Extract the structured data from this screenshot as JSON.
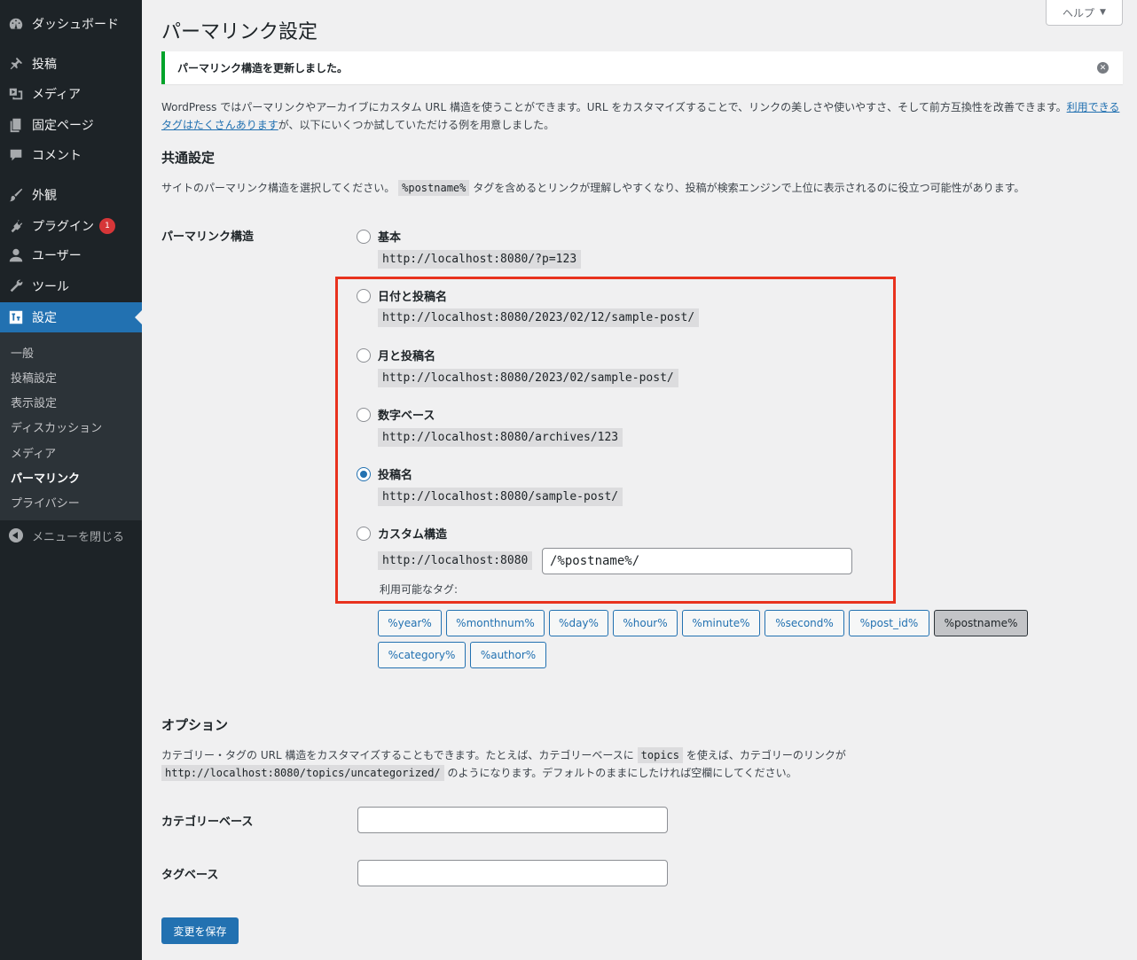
{
  "sidebar": {
    "items": [
      {
        "label": "ダッシュボード",
        "icon": "dashboard-icon"
      },
      {
        "label": "投稿",
        "icon": "pin-icon"
      },
      {
        "label": "メディア",
        "icon": "media-icon"
      },
      {
        "label": "固定ページ",
        "icon": "page-icon"
      },
      {
        "label": "コメント",
        "icon": "comment-icon"
      },
      {
        "label": "外観",
        "icon": "brush-icon"
      },
      {
        "label": "プラグイン",
        "icon": "plugin-icon",
        "badge": "1"
      },
      {
        "label": "ユーザー",
        "icon": "user-icon"
      },
      {
        "label": "ツール",
        "icon": "wrench-icon"
      },
      {
        "label": "設定",
        "icon": "settings-icon"
      }
    ],
    "submenu": [
      "一般",
      "投稿設定",
      "表示設定",
      "ディスカッション",
      "メディア",
      "パーマリンク",
      "プライバシー"
    ],
    "collapse_label": "メニューを閉じる"
  },
  "header": {
    "help_label": "ヘルプ",
    "title": "パーマリンク設定"
  },
  "notice": {
    "text": "パーマリンク構造を更新しました。"
  },
  "intro": {
    "text_before": "WordPress ではパーマリンクやアーカイブにカスタム URL 構造を使うことができます。URL をカスタマイズすることで、リンクの美しさや使いやすさ、そして前方互換性を改善できます。",
    "link": "利用できるタグはたくさんあります",
    "text_after": "が、以下にいくつか試していただける例を用意しました。"
  },
  "common": {
    "heading": "共通設定",
    "desc_before": "サイトのパーマリンク構造を選択してください。",
    "desc_code": "%postname%",
    "desc_after": "タグを含めるとリンクが理解しやすくなり、投稿が検索エンジンで上位に表示されるのに役立つ可能性があります。",
    "field_label": "パーマリンク構造"
  },
  "structures": [
    {
      "label": "基本",
      "url": "http://localhost:8080/?p=123",
      "checked": false
    },
    {
      "label": "日付と投稿名",
      "url": "http://localhost:8080/2023/02/12/sample-post/",
      "checked": false
    },
    {
      "label": "月と投稿名",
      "url": "http://localhost:8080/2023/02/sample-post/",
      "checked": false
    },
    {
      "label": "数字ベース",
      "url": "http://localhost:8080/archives/123",
      "checked": false
    },
    {
      "label": "投稿名",
      "url": "http://localhost:8080/sample-post/",
      "checked": true
    },
    {
      "label": "カスタム構造",
      "url": "http://localhost:8080",
      "checked": false
    }
  ],
  "custom": {
    "value": "/%postname%/",
    "tags_label": "利用可能なタグ:",
    "tags": [
      "%year%",
      "%monthnum%",
      "%day%",
      "%hour%",
      "%minute%",
      "%second%",
      "%post_id%",
      "%postname%",
      "%category%",
      "%author%"
    ]
  },
  "options": {
    "heading": "オプション",
    "line1_before": "カテゴリー・タグの URL 構造をカスタマイズすることもできます。たとえば、カテゴリーベースに",
    "line1_code": "topics",
    "line1_after": "を使えば、カテゴリーのリンクが",
    "line2_code": "http://localhost:8080/topics/uncategorized/",
    "line2_after": "のようになります。デフォルトのままにしたければ空欄にしてください。",
    "category_label": "カテゴリーベース",
    "tag_label": "タグベース"
  },
  "save_label": "変更を保存",
  "colors": {
    "accent": "#2271b1",
    "sidebar": "#1d2327",
    "notice_success": "#00a32a",
    "highlight": "#e8321e"
  }
}
